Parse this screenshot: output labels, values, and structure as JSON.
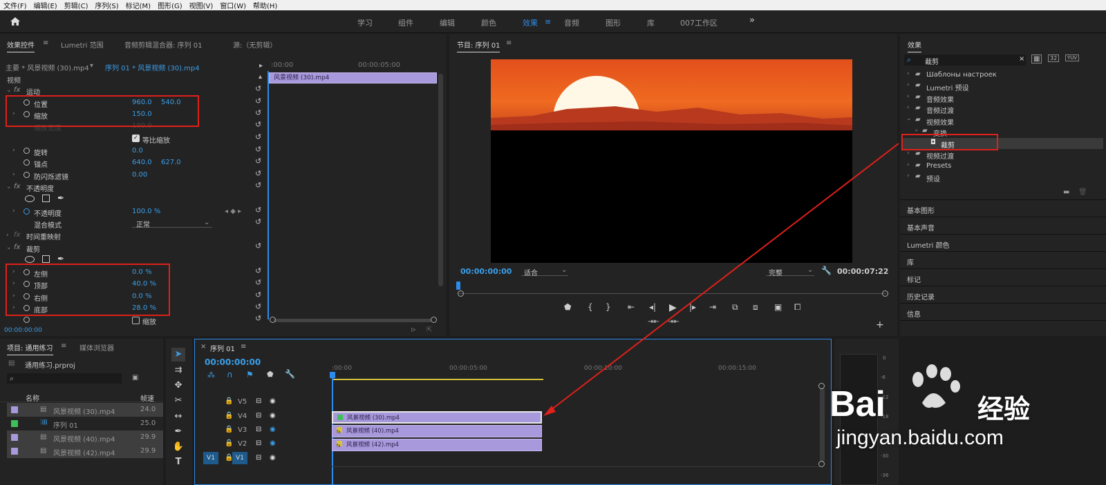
{
  "menu": [
    "文件(F)",
    "编辑(E)",
    "剪辑(C)",
    "序列(S)",
    "标记(M)",
    "图形(G)",
    "视图(V)",
    "窗口(W)",
    "帮助(H)"
  ],
  "workspaces": [
    "学习",
    "组件",
    "编辑",
    "颜色",
    "效果",
    "音频",
    "图形",
    "库",
    "007工作区"
  ],
  "ws_more": "»",
  "ws_active_icon": "≡",
  "effect_controls": {
    "tabs": [
      "效果控件",
      "Lumetri 范围",
      "音频剪辑混合器: 序列 01",
      "源:（无剪辑）"
    ],
    "tab_menu": "≡",
    "master": "主要 * 风景视频 (30).mp4",
    "sequence": "序列 01 * 风景视频 (30).mp4",
    "ruler": [
      ":00:00",
      "00:00:05:00"
    ],
    "clip_label": "风景视频 (30).mp4",
    "section_video": "视频",
    "motion": "运动",
    "position_label": "位置",
    "position_x": "960.0",
    "position_y": "540.0",
    "scale_label": "缩放",
    "scale_value": "150.0",
    "scale_width_label": "缩放宽度",
    "scale_width_value": "100.0",
    "uniform_label": "等比缩放",
    "rotation_label": "旋转",
    "rotation_value": "0.0",
    "anchor_label": "锚点",
    "anchor_x": "640.0",
    "anchor_y": "627.0",
    "flicker_label": "防闪烁滤镜",
    "flicker_value": "0.00",
    "opacity_section": "不透明度",
    "opacity_label": "不透明度",
    "opacity_value": "100.0 %",
    "blend_label": "混合模式",
    "blend_value": "正常",
    "time_remap": "时间重映射",
    "crop_section": "裁剪",
    "left_label": "左侧",
    "left_value": "0.0 %",
    "top_label": "顶部",
    "top_value": "40.0 %",
    "right_label": "右侧",
    "right_value": "0.0 %",
    "bottom_label": "底部",
    "bottom_value": "28.0 %",
    "zoom_label": "缩放",
    "timecode": "00:00:00:00"
  },
  "program": {
    "title": "节目: 序列 01",
    "title_menu": "≡",
    "timecode": "00:00:00:00",
    "fit": "适合",
    "quality": "完整",
    "duration": "00:00:07:22"
  },
  "effects_panel": {
    "title": "效果",
    "search": "裁剪",
    "icon_labels": [
      "32",
      "YUV"
    ],
    "items": [
      "Шаблоны настроек",
      "Lumetri 预设",
      "音频效果",
      "音频过渡",
      "视频效果",
      "变换",
      "裁剪",
      "视频过渡",
      "Presets",
      "预设"
    ],
    "sections": [
      "基本图形",
      "基本声音",
      "Lumetri 颜色",
      "库",
      "标记",
      "历史记录",
      "信息"
    ]
  },
  "project": {
    "tabs": [
      "项目: 通用练习",
      "媒体浏览器"
    ],
    "tab_menu": "≡",
    "file": "通用练习.prproj",
    "col_name": "名称",
    "col_rate": "帧速",
    "rows": [
      {
        "name": "风景视频 (30).mp4",
        "rate": "24.0"
      },
      {
        "name": "序列 01",
        "rate": "25.0"
      },
      {
        "name": "风景视频 (40).mp4",
        "rate": "29.9"
      },
      {
        "name": "风景视频 (42).mp4",
        "rate": "29.9"
      }
    ]
  },
  "timeline": {
    "title": "序列 01",
    "close": "×",
    "title_menu": "≡",
    "timecode": "00:00:00:00",
    "ruler": [
      ":00:00",
      "00:00:05:00",
      "00:00:10:00",
      "00:00:15:00"
    ],
    "tracks": [
      "V5",
      "V4",
      "V3",
      "V2",
      "V1"
    ],
    "src_patch": "V1",
    "clips": [
      "风景视频 (30).mp4",
      "风景视频 (40).mp4",
      "风景视频 (42).mp4"
    ]
  },
  "meter_labels": [
    "0",
    "-6",
    "-12",
    "-18",
    "-24",
    "-30",
    "-36"
  ],
  "watermark": {
    "brand": "Bai",
    "brand2": "经验",
    "url": "jingyan.baidu.com"
  },
  "colors": {
    "accent": "#2d8ceb",
    "clip": "#a898dc",
    "highlight": "#e0201a",
    "green": "#3fbf5a"
  }
}
